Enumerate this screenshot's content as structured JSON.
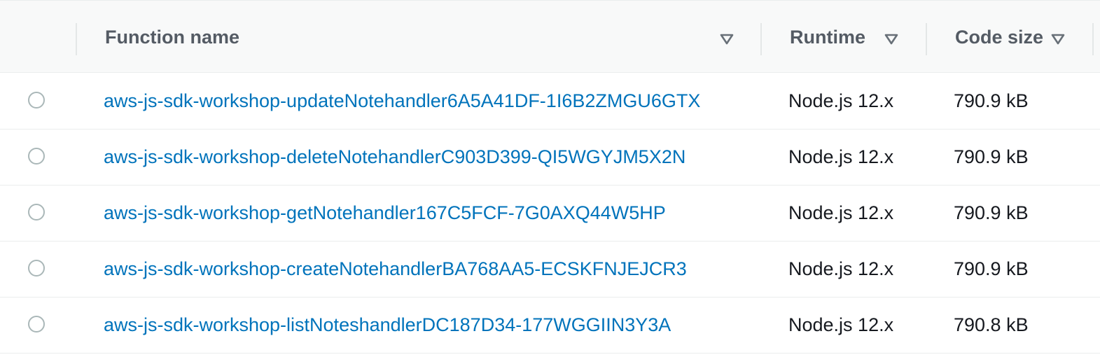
{
  "columns": {
    "function_name": "Function name",
    "runtime": "Runtime",
    "code_size": "Code size"
  },
  "rows": [
    {
      "name": "aws-js-sdk-workshop-updateNotehandler6A5A41DF-1I6B2ZMGU6GTX",
      "runtime": "Node.js 12.x",
      "code_size": "790.9 kB"
    },
    {
      "name": "aws-js-sdk-workshop-deleteNotehandlerC903D399-QI5WGYJM5X2N",
      "runtime": "Node.js 12.x",
      "code_size": "790.9 kB"
    },
    {
      "name": "aws-js-sdk-workshop-getNotehandler167C5FCF-7G0AXQ44W5HP",
      "runtime": "Node.js 12.x",
      "code_size": "790.9 kB"
    },
    {
      "name": "aws-js-sdk-workshop-createNotehandlerBA768AA5-ECSKFNJEJCR3",
      "runtime": "Node.js 12.x",
      "code_size": "790.9 kB"
    },
    {
      "name": "aws-js-sdk-workshop-listNoteshandlerDC187D34-177WGGIIN3Y3A",
      "runtime": "Node.js 12.x",
      "code_size": "790.8 kB"
    }
  ]
}
